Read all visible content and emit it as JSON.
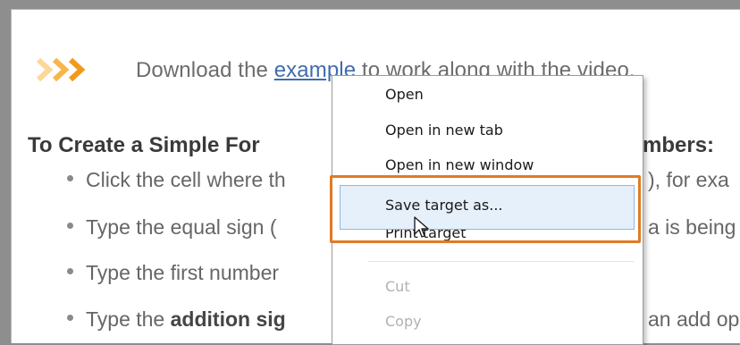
{
  "content": {
    "intro_before": "Download the ",
    "intro_link": "example",
    "intro_after": " to work along with the video.",
    "heading_left": "To Create a Simple For",
    "heading_right": "mbers:",
    "bullets": [
      {
        "left": "Click the cell where th",
        "right": "), for exa"
      },
      {
        "left": "Type the equal sign (",
        "right": "a is being"
      },
      {
        "left": "Type the first number",
        "right": ""
      },
      {
        "left_plain": "Type the ",
        "left_bold": "addition sig",
        "right": "an add op"
      }
    ]
  },
  "context_menu": {
    "items": [
      {
        "label": "Open",
        "enabled": true
      },
      {
        "label": "Open in new tab",
        "enabled": true
      },
      {
        "label": "Open in new window",
        "enabled": true
      },
      {
        "label": "Save target as...",
        "enabled": true,
        "highlighted": true
      },
      {
        "label": "Print target",
        "enabled": true
      },
      {
        "label": "Cut",
        "enabled": false
      },
      {
        "label": "Copy",
        "enabled": false
      }
    ]
  },
  "colors": {
    "accent": "#f29a1b",
    "link": "#3f6cad",
    "highlight_border": "#e07b24"
  },
  "icons": {
    "arrows": "triple-chevron-right-icon",
    "cursor": "mouse-pointer-icon"
  }
}
